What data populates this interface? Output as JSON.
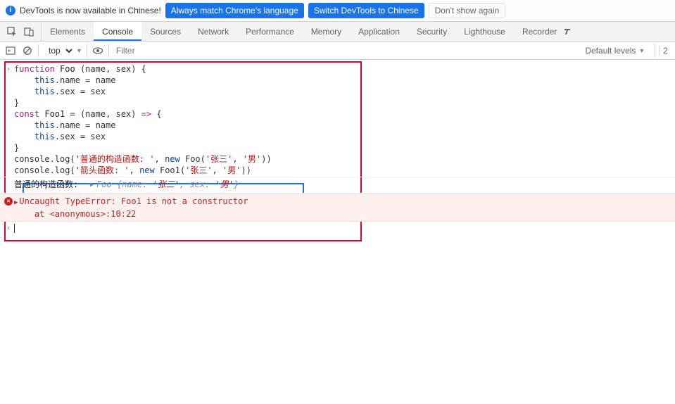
{
  "infobar": {
    "msg": "DevTools is now available in Chinese!",
    "btn_match": "Always match Chrome's language",
    "btn_switch": "Switch DevTools to Chinese",
    "btn_dismiss": "Don't show again"
  },
  "tabs": [
    "Elements",
    "Console",
    "Sources",
    "Network",
    "Performance",
    "Memory",
    "Application",
    "Security",
    "Lighthouse",
    "Recorder"
  ],
  "active_tab": "Console",
  "console_toolbar": {
    "context": "top",
    "filter_placeholder": "Filter",
    "levels_label": "Default levels",
    "issue_count": "2"
  },
  "code": {
    "line1": "function Foo (name, sex) {",
    "line2": "    this.name = name",
    "line3": "    this.sex = sex",
    "line4": "}",
    "line5": "const Foo1 = (name, sex) => {",
    "line6": "    this.name = name",
    "line7": "    this.sex = sex",
    "line8": "}",
    "line9_pre": "console.log(",
    "line9_s1": "'普通的构造函数: '",
    "line9_mid": ", new Foo(",
    "line9_s2": "'张三'",
    "line9_s3": "'男'",
    "line9_end": "))",
    "line10_pre": "console.log(",
    "line10_s1": "'箭头函数: '",
    "line10_mid": ", new Foo1(",
    "line10_s2": "'张三'",
    "line10_s3": "'男'",
    "line10_end": "))"
  },
  "result": {
    "label": "普通的构造函数:  ",
    "preview_head": "Foo {name: ",
    "preview_v1": "'张三'",
    "preview_mid": ", sex: ",
    "preview_v2": "'男'",
    "preview_tail": "}"
  },
  "error": {
    "msg": "Uncaught TypeError: Foo1 is not a constructor",
    "trace": "    at <anonymous>:10:22"
  }
}
